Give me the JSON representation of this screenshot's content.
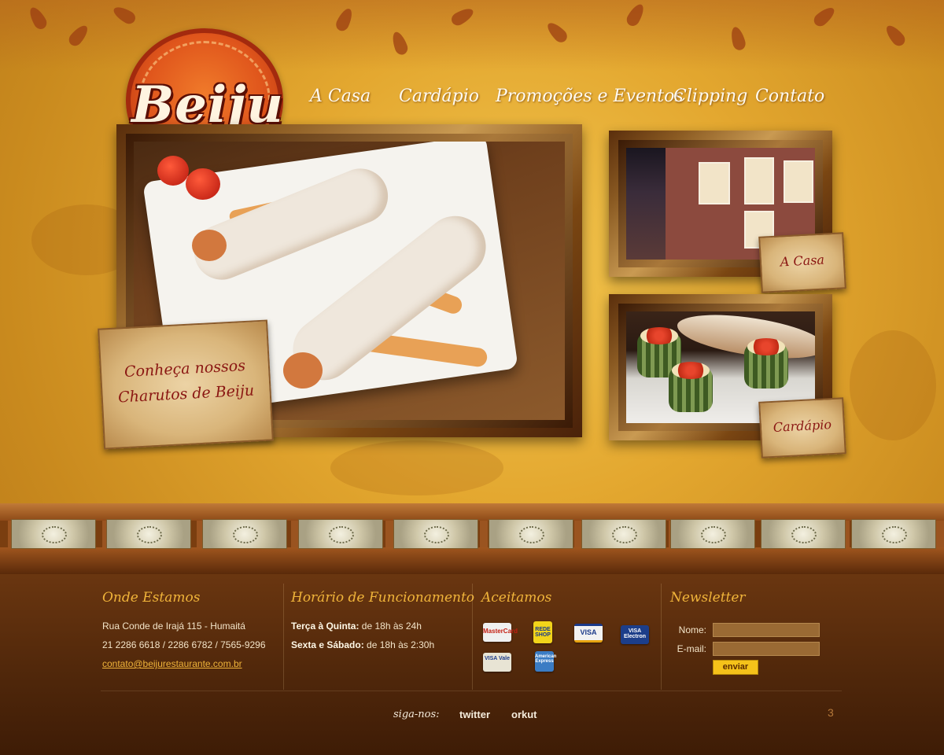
{
  "brand": {
    "logo_text": "Beiju"
  },
  "nav": {
    "items": [
      {
        "label": "A Casa"
      },
      {
        "label": "Cardápio"
      },
      {
        "label": "Promoções e Eventos"
      },
      {
        "label": "Clipping"
      },
      {
        "label": "Contato"
      }
    ]
  },
  "feature": {
    "line1": "Conheça nossos",
    "line2": "Charutos de Beiju"
  },
  "side_cards": {
    "house": {
      "label": "A Casa"
    },
    "menu": {
      "label": "Cardápio"
    }
  },
  "footer": {
    "location": {
      "title": "Onde Estamos",
      "address": "Rua Conde de Irajá 115 - Humaitá",
      "phones": "21 2286 6618 / 2286 6782 / 7565-9296",
      "email": "contato@beijurestaurante.com.br"
    },
    "hours": {
      "title": "Horário de Funcionamento",
      "rows": [
        {
          "days": "Terça à Quinta:",
          "time": " de 18h às 24h"
        },
        {
          "days": "Sexta e Sábado:",
          "time": " de 18h às 2:30h"
        }
      ]
    },
    "payments": {
      "title": "Aceitamos",
      "cards": [
        {
          "name": "MasterCard",
          "color": "#f0f0f0"
        },
        {
          "name": "REDE SHOP",
          "color": "#f2d41a"
        },
        {
          "name": "VISA",
          "color": "#f2f2f2"
        },
        {
          "name": "VISA Electron",
          "color": "#1c3e8a"
        },
        {
          "name": "VISA Vale",
          "color": "#e8e4d4"
        },
        {
          "name": "American Express",
          "color": "#3b7cc4"
        }
      ]
    },
    "newsletter": {
      "title": "Newsletter",
      "name_label": "Nome:",
      "email_label": "E-mail:",
      "submit_label": "enviar"
    },
    "social": {
      "follow_label": "siga-nos:",
      "twitter": "twitter",
      "orkut": "orkut"
    },
    "page_number": "3"
  },
  "colors": {
    "accent": "#f0b43a",
    "label_red": "#8a1612",
    "footer_bg": "#4e260a"
  }
}
